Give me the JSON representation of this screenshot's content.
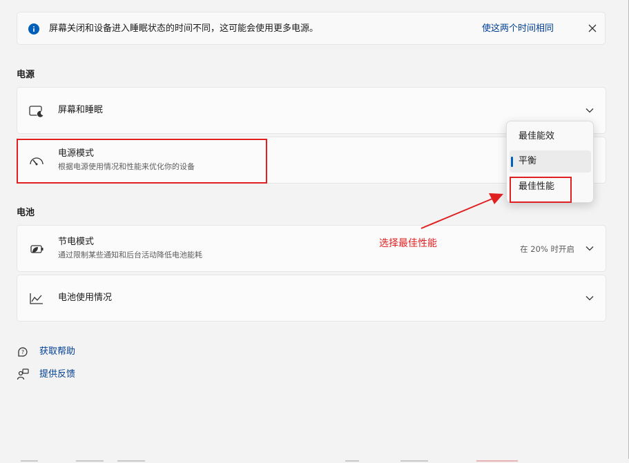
{
  "banner": {
    "message": "屏幕关闭和设备进入睡眠状态的时间不同，这可能会使用更多电源。",
    "action_link": "使这两个时间相同",
    "info_icon": "info-icon",
    "close_icon": "close-icon"
  },
  "power_section": {
    "title": "电源",
    "screen_sleep": {
      "title": "屏幕和睡眠",
      "icon": "screen-sleep-icon"
    },
    "power_mode": {
      "title": "电源模式",
      "subtitle": "根据电源使用情况和性能来优化你的设备",
      "icon": "speedometer-icon",
      "options": [
        "最佳能效",
        "平衡",
        "最佳性能"
      ],
      "selected": "平衡"
    }
  },
  "battery_section": {
    "title": "电池",
    "battery_saver": {
      "title": "节电模式",
      "subtitle": "通过限制某些通知和后台活动降低电池能耗",
      "status": "在 20% 时开启",
      "icon": "battery-leaf-icon"
    },
    "battery_usage": {
      "title": "电池使用情况",
      "icon": "line-chart-icon"
    }
  },
  "annotation": {
    "text": "选择最佳性能",
    "color": "#e02020"
  },
  "links": [
    {
      "label": "获取帮助",
      "icon": "help-chat-icon"
    },
    {
      "label": "提供反馈",
      "icon": "feedback-icon"
    }
  ],
  "colors": {
    "accent": "#005fb8",
    "link": "#003e92",
    "annotation_red": "#e02020"
  }
}
